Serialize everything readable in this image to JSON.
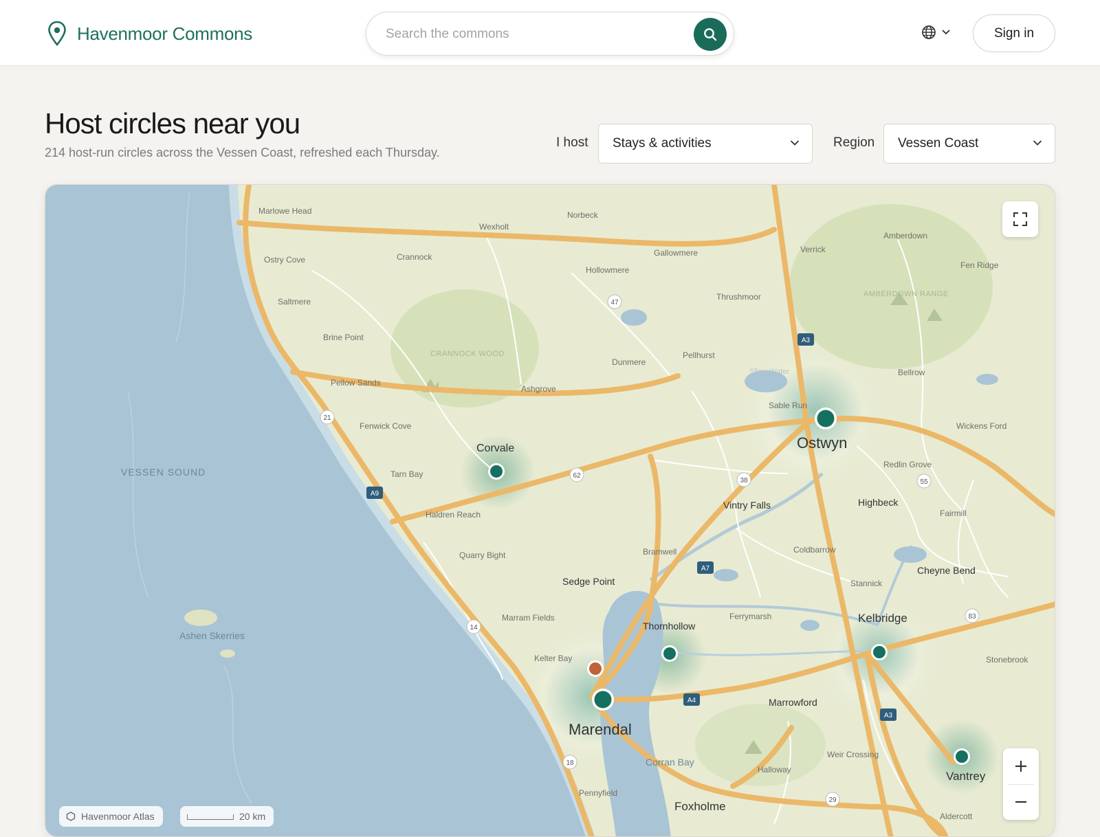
{
  "header": {
    "brand": "Havenmoor Commons",
    "search_placeholder": "Search the commons",
    "sign_in": "Sign in"
  },
  "page": {
    "title": "Host circles near you",
    "subtitle": "214 host-run circles across the Vessen Coast, refreshed each Thursday."
  },
  "filters": {
    "host_label": "I host",
    "host_value": "Stays & activities",
    "region_label": "Region",
    "region_value": "Vessen Coast"
  },
  "map": {
    "attribution": "Havenmoor Atlas",
    "scale_label": "20 km",
    "colors": {
      "water": "#a9c4d4",
      "land": "#e8ebd2",
      "forest": "#d5e0b9",
      "road": "#f0b45c",
      "marker": "#16705f",
      "marker_alt": "#c0633a"
    },
    "water_labels": {
      "sound": "VESSEN SOUND",
      "skerries": "Ashen Skerries",
      "bay": "Corran Bay"
    },
    "area_labels": {
      "wood": "CRANNOCK WOOD",
      "range": "AMBERDOWN RANGE",
      "slow_water": "Sllow Water"
    },
    "towns": {
      "marlowe_head": "Marlowe Head",
      "norbeck": "Norbeck",
      "wexholt": "Wexholt",
      "gallowmere": "Gallowmere",
      "verrick": "Verrick",
      "amberdown": "Amberdown",
      "fen_ridge": "Fen Ridge",
      "ostry_cove": "Ostry Cove",
      "crannock": "Crannock",
      "hollowmere": "Hollowmere",
      "saltmere": "Saltmere",
      "thrushmoor": "Thrushmoor",
      "brine_point": "Brine Point",
      "pellhurst": "Pellhurst",
      "dunmere": "Dunmere",
      "pellow_sands": "Pellow Sands",
      "ashgrove": "Ashgrove",
      "bellrow": "Bellrow",
      "sable_run": "Sable Run",
      "fenwick_cove": "Fenwick Cove",
      "wickens_ford": "Wickens Ford",
      "tarn_bay": "Tarn Bay",
      "redlin_grove": "Redlin Grove",
      "haldren_reach": "Haldren Reach",
      "fairmill": "Fairmill",
      "bramwell": "Bramwell",
      "coldbarrow": "Coldbarrow",
      "quarry_bight": "Quarry Bight",
      "stannick": "Stannick",
      "marram_fields": "Marram Fields",
      "ferrymarsh": "Ferrymarsh",
      "stonebrook": "Stonebrook",
      "kelter_bay": "Kelter Bay",
      "weir_crossing": "Weir Crossing",
      "halloway": "Halloway",
      "pennyfield": "Pennyfield",
      "aldercott": "Aldercott"
    },
    "major_towns": {
      "ostwyn": "Ostwyn",
      "marendal": "Marendal",
      "corvale": "Corvale",
      "vintry_falls": "Vintry Falls",
      "highbeck": "Highbeck",
      "sedge_point": "Sedge Point",
      "cheyne_bend": "Cheyne Bend",
      "thornhollow": "Thornhollow",
      "kelbridge": "Kelbridge",
      "marrowford": "Marrowford",
      "vantrey": "Vantrey",
      "foxholme": "Foxholme"
    },
    "route_shields": [
      "A3",
      "A9",
      "A7",
      "A4",
      "A3"
    ],
    "route_circles": [
      "47",
      "21",
      "62",
      "38",
      "55",
      "14",
      "83",
      "18",
      "29"
    ],
    "markers": [
      {
        "place": "Ostwyn",
        "kind": "circle",
        "size": "large"
      },
      {
        "place": "Corvale",
        "kind": "circle",
        "size": "small"
      },
      {
        "place": "Thornhollow",
        "kind": "circle",
        "size": "small"
      },
      {
        "place": "Kelbridge",
        "kind": "circle",
        "size": "small"
      },
      {
        "place": "Marendal",
        "kind": "circle",
        "size": "large"
      },
      {
        "place": "Kelter Bay",
        "kind": "alternate",
        "size": "small"
      },
      {
        "place": "Vantrey",
        "kind": "circle",
        "size": "small"
      }
    ]
  }
}
